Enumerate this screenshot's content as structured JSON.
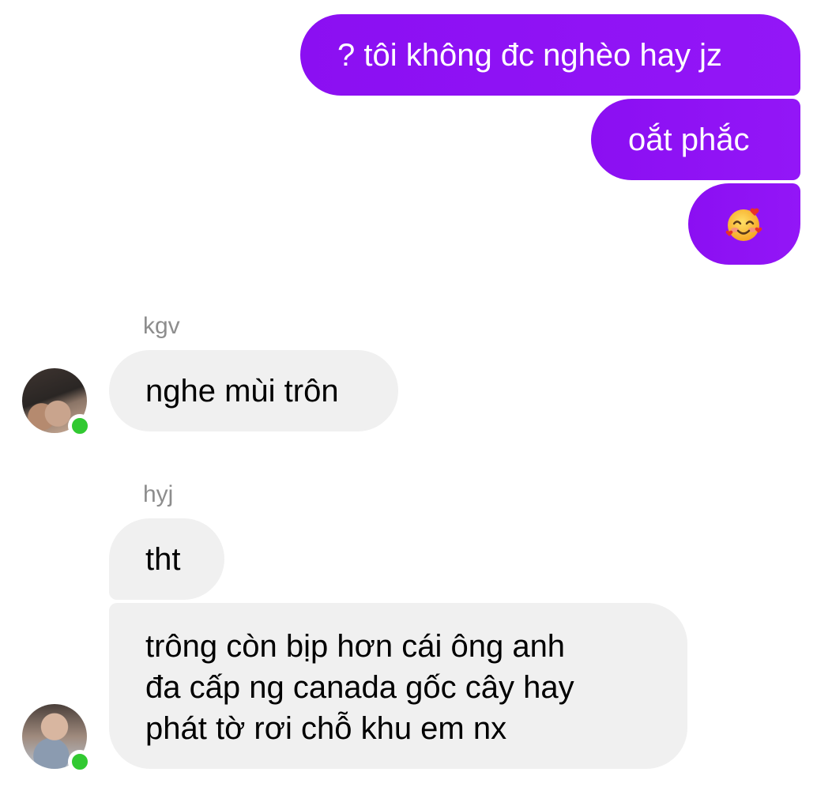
{
  "colors": {
    "outgoing_bubble": "#8b0ff2",
    "incoming_bubble": "#f0f0f0",
    "online_dot": "#31c931",
    "sender_name": "#8d8d8d"
  },
  "outgoing": [
    {
      "text": "? tôi không đc nghèo hay jz"
    },
    {
      "text": "oắt phắc"
    },
    {
      "emoji": "smiling-face-with-hearts"
    }
  ],
  "incoming": [
    {
      "sender": "kgv",
      "messages": [
        {
          "text": "nghe mùi trôn"
        }
      ]
    },
    {
      "sender": "hyj",
      "messages": [
        {
          "text": "tht"
        },
        {
          "text": "trông còn bịp hơn cái ông anh\nđa cấp ng canada gốc cây hay\nphát tờ rơi chỗ khu em nx"
        }
      ]
    }
  ]
}
